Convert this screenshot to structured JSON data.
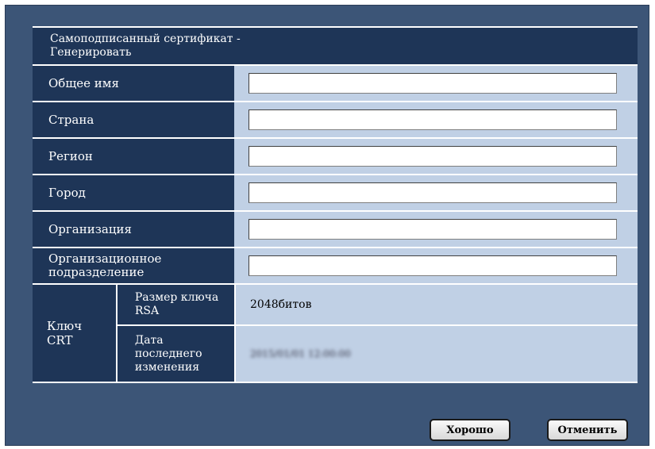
{
  "header": {
    "title_line1": "Самоподписанный сертификат -",
    "title_line2": "Генерировать"
  },
  "fields": [
    {
      "label": "Общее имя",
      "value": ""
    },
    {
      "label": "Страна",
      "value": ""
    },
    {
      "label": "Регион",
      "value": ""
    },
    {
      "label": "Город",
      "value": ""
    },
    {
      "label": "Организация",
      "value": ""
    },
    {
      "label_line1": "Организационное",
      "label_line2": "подразделение",
      "value": ""
    }
  ],
  "crt_key": {
    "label_line1": "Ключ",
    "label_line2": "CRT",
    "rsa_size_label_line1": "Размер ключа",
    "rsa_size_label_line2": "RSA",
    "rsa_size_value": "2048битов",
    "modified_label_line1": "Дата",
    "modified_label_line2": "последнего",
    "modified_label_line3": "изменения",
    "modified_value": "2015/01/01 12:00:00"
  },
  "buttons": {
    "ok": "Хорошо",
    "cancel": "Отменить"
  },
  "colors": {
    "frame": "#3c5577",
    "label_bg": "#1e3557",
    "value_bg": "#c0d0e5"
  }
}
